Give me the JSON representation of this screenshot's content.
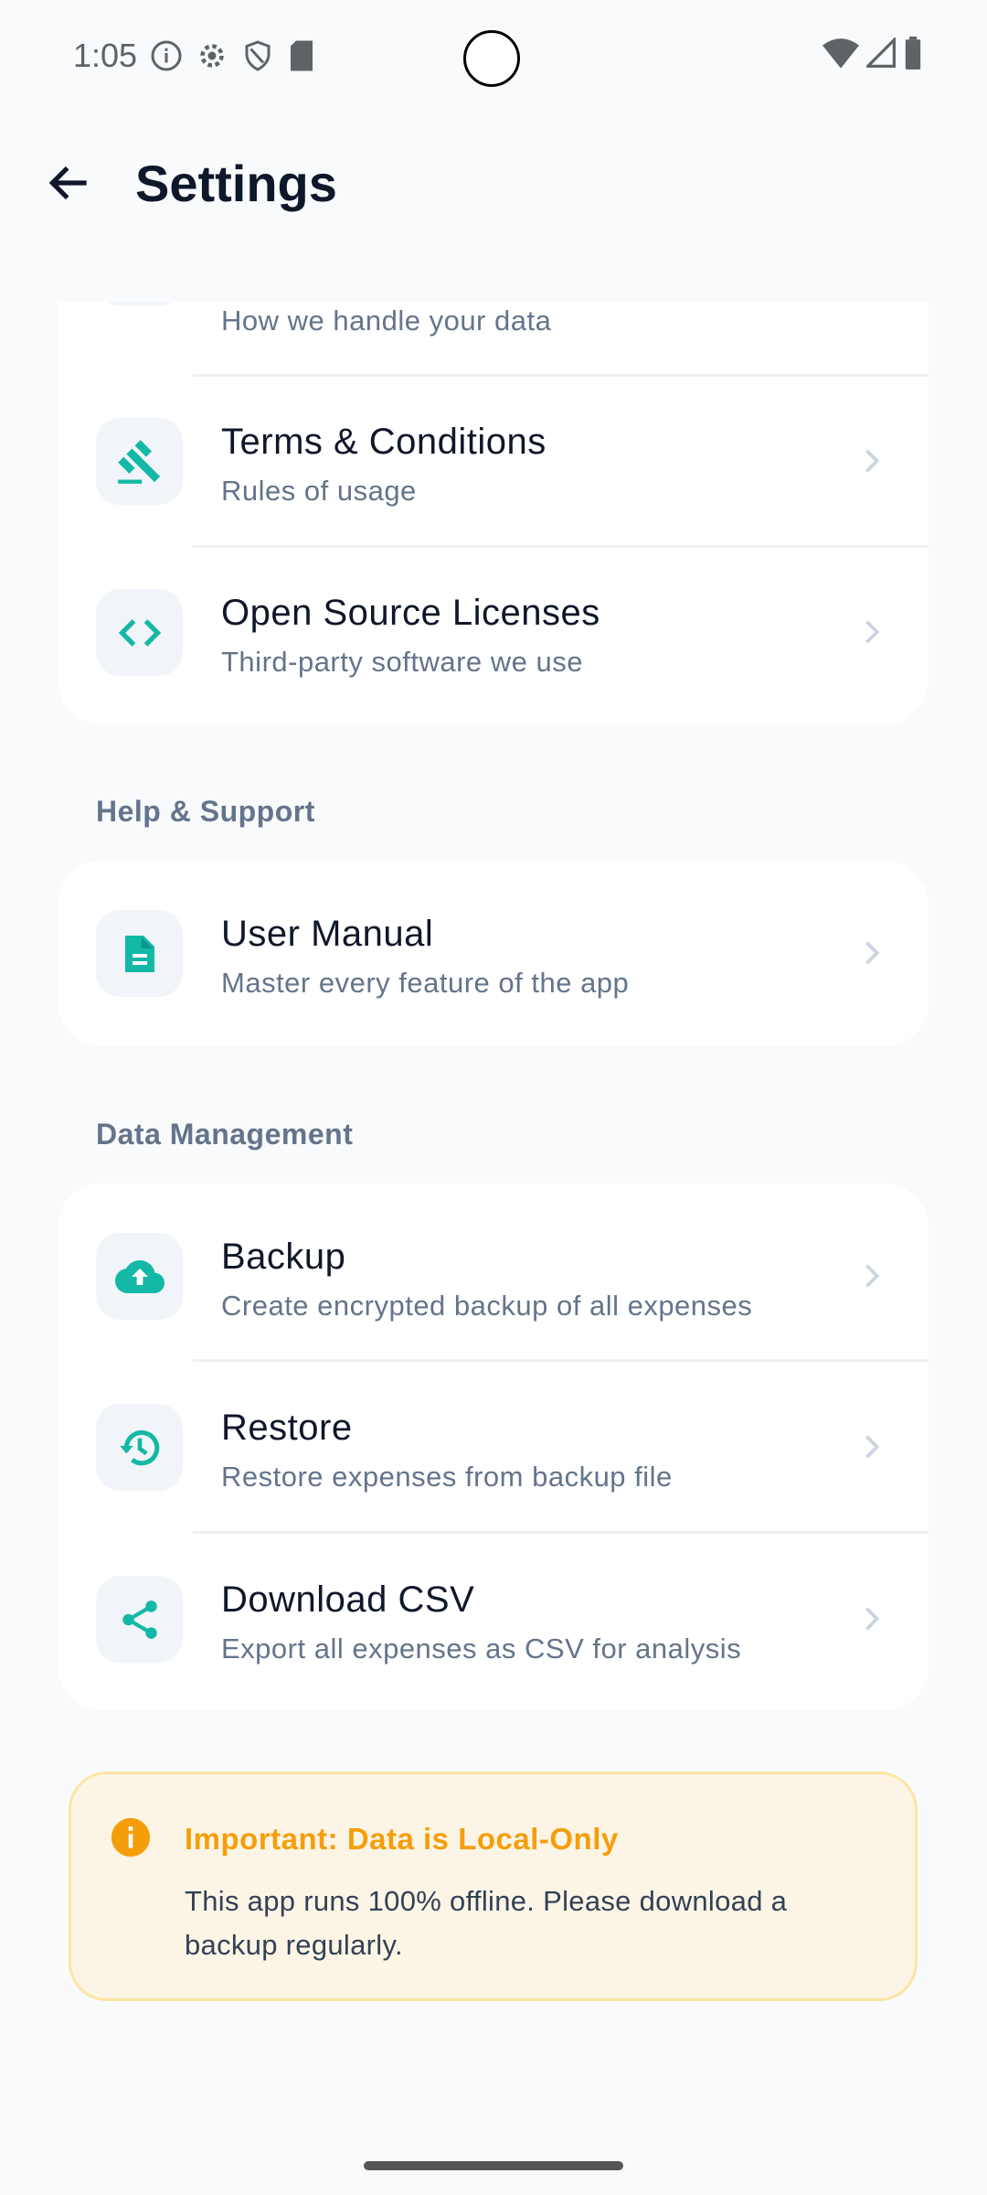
{
  "status_bar": {
    "time": "1:05",
    "icons": [
      "info-icon",
      "gear-icon",
      "shield-icon",
      "sd-card-icon",
      "wifi-icon",
      "signal-icon",
      "battery-icon"
    ]
  },
  "header": {
    "title": "Settings",
    "back_icon": "arrow-left-icon"
  },
  "colors": {
    "accent": "#14b8a6",
    "background": "#f8fafc",
    "warning": "#f59e0b"
  },
  "legal": {
    "items": [
      {
        "title": "",
        "subtitle": "How we handle your data"
      },
      {
        "title": "Terms & Conditions",
        "subtitle": "Rules of usage",
        "icon": "gavel-icon"
      },
      {
        "title": "Open Source Licenses",
        "subtitle": "Third-party software we use",
        "icon": "code-icon"
      }
    ]
  },
  "help": {
    "header": "Help & Support",
    "items": [
      {
        "title": "User Manual",
        "subtitle": "Master every feature of the app",
        "icon": "document-icon"
      }
    ]
  },
  "data_management": {
    "header": "Data Management",
    "items": [
      {
        "title": "Backup",
        "subtitle": "Create encrypted backup of all expenses",
        "icon": "cloud-upload-icon"
      },
      {
        "title": "Restore",
        "subtitle": "Restore expenses from backup file",
        "icon": "history-icon"
      },
      {
        "title": "Download CSV",
        "subtitle": "Export all expenses as CSV for analysis",
        "icon": "share-icon"
      }
    ]
  },
  "notice": {
    "title": "Important: Data is Local-Only",
    "body": "This app runs 100% offline. Please download a backup regularly."
  }
}
